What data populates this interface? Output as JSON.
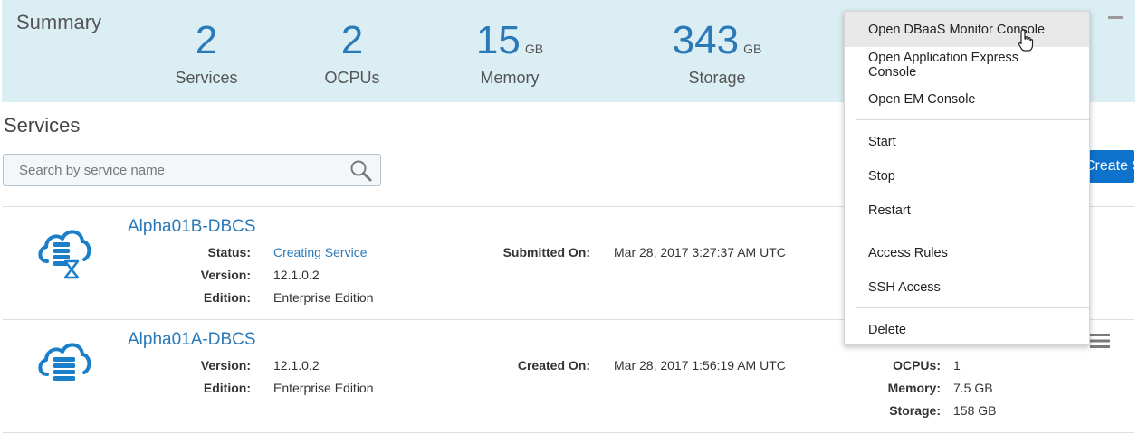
{
  "summary": {
    "title": "Summary",
    "metrics": [
      {
        "value": "2",
        "unit": "",
        "label": "Services"
      },
      {
        "value": "2",
        "unit": "",
        "label": "OCPUs"
      },
      {
        "value": "15",
        "unit": "GB",
        "label": "Memory"
      },
      {
        "value": "343",
        "unit": "GB",
        "label": "Storage"
      }
    ]
  },
  "services": {
    "title": "Services",
    "search_placeholder": "Search by service name",
    "create_button_label": "Create Service"
  },
  "rows": [
    {
      "name": "Alpha01B-DBCS",
      "status_label": "Status:",
      "status_value": "Creating Service",
      "version_label": "Version:",
      "version_value": "12.1.0.2",
      "edition_label": "Edition:",
      "edition_value": "Enterprise Edition",
      "date_label": "Submitted On:",
      "date_value": "Mar 28, 2017 3:27:37 AM UTC"
    },
    {
      "name": "Alpha01A-DBCS",
      "version_label": "Version:",
      "version_value": "12.1.0.2",
      "edition_label": "Edition:",
      "edition_value": "Enterprise Edition",
      "date_label": "Created On:",
      "date_value": "Mar 28, 2017 1:56:19 AM UTC",
      "ocpus_label": "OCPUs:",
      "ocpus_value": "1",
      "memory_label": "Memory:",
      "memory_value": "7.5 GB",
      "storage_label": "Storage:",
      "storage_value": "158 GB"
    }
  ],
  "menu": {
    "items": [
      "Open DBaaS Monitor Console",
      "Open Application Express Console",
      "Open EM Console",
      "Start",
      "Stop",
      "Restart",
      "Access Rules",
      "SSH Access",
      "Delete"
    ],
    "hovered": "Open DBaaS Monitor Console"
  },
  "colors": {
    "accent": "#2a79b9",
    "summary_bg": "#daeef3",
    "button_bg": "#0c72cc"
  },
  "icons": [
    "search-icon",
    "cloud-database-creating-icon",
    "cloud-database-icon",
    "hamburger-menu-icon",
    "collapse-icon"
  ]
}
